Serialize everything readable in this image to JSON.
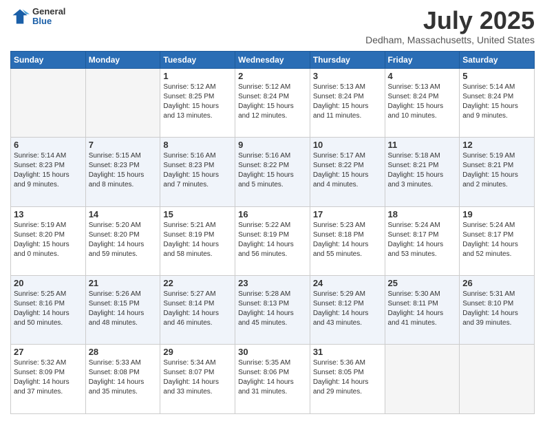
{
  "logo": {
    "general": "General",
    "blue": "Blue"
  },
  "header": {
    "month": "July 2025",
    "location": "Dedham, Massachusetts, United States"
  },
  "weekdays": [
    "Sunday",
    "Monday",
    "Tuesday",
    "Wednesday",
    "Thursday",
    "Friday",
    "Saturday"
  ],
  "weeks": [
    [
      {
        "day": "",
        "info": ""
      },
      {
        "day": "",
        "info": ""
      },
      {
        "day": "1",
        "info": "Sunrise: 5:12 AM\nSunset: 8:25 PM\nDaylight: 15 hours\nand 13 minutes."
      },
      {
        "day": "2",
        "info": "Sunrise: 5:12 AM\nSunset: 8:24 PM\nDaylight: 15 hours\nand 12 minutes."
      },
      {
        "day": "3",
        "info": "Sunrise: 5:13 AM\nSunset: 8:24 PM\nDaylight: 15 hours\nand 11 minutes."
      },
      {
        "day": "4",
        "info": "Sunrise: 5:13 AM\nSunset: 8:24 PM\nDaylight: 15 hours\nand 10 minutes."
      },
      {
        "day": "5",
        "info": "Sunrise: 5:14 AM\nSunset: 8:24 PM\nDaylight: 15 hours\nand 9 minutes."
      }
    ],
    [
      {
        "day": "6",
        "info": "Sunrise: 5:14 AM\nSunset: 8:23 PM\nDaylight: 15 hours\nand 9 minutes."
      },
      {
        "day": "7",
        "info": "Sunrise: 5:15 AM\nSunset: 8:23 PM\nDaylight: 15 hours\nand 8 minutes."
      },
      {
        "day": "8",
        "info": "Sunrise: 5:16 AM\nSunset: 8:23 PM\nDaylight: 15 hours\nand 7 minutes."
      },
      {
        "day": "9",
        "info": "Sunrise: 5:16 AM\nSunset: 8:22 PM\nDaylight: 15 hours\nand 5 minutes."
      },
      {
        "day": "10",
        "info": "Sunrise: 5:17 AM\nSunset: 8:22 PM\nDaylight: 15 hours\nand 4 minutes."
      },
      {
        "day": "11",
        "info": "Sunrise: 5:18 AM\nSunset: 8:21 PM\nDaylight: 15 hours\nand 3 minutes."
      },
      {
        "day": "12",
        "info": "Sunrise: 5:19 AM\nSunset: 8:21 PM\nDaylight: 15 hours\nand 2 minutes."
      }
    ],
    [
      {
        "day": "13",
        "info": "Sunrise: 5:19 AM\nSunset: 8:20 PM\nDaylight: 15 hours\nand 0 minutes."
      },
      {
        "day": "14",
        "info": "Sunrise: 5:20 AM\nSunset: 8:20 PM\nDaylight: 14 hours\nand 59 minutes."
      },
      {
        "day": "15",
        "info": "Sunrise: 5:21 AM\nSunset: 8:19 PM\nDaylight: 14 hours\nand 58 minutes."
      },
      {
        "day": "16",
        "info": "Sunrise: 5:22 AM\nSunset: 8:19 PM\nDaylight: 14 hours\nand 56 minutes."
      },
      {
        "day": "17",
        "info": "Sunrise: 5:23 AM\nSunset: 8:18 PM\nDaylight: 14 hours\nand 55 minutes."
      },
      {
        "day": "18",
        "info": "Sunrise: 5:24 AM\nSunset: 8:17 PM\nDaylight: 14 hours\nand 53 minutes."
      },
      {
        "day": "19",
        "info": "Sunrise: 5:24 AM\nSunset: 8:17 PM\nDaylight: 14 hours\nand 52 minutes."
      }
    ],
    [
      {
        "day": "20",
        "info": "Sunrise: 5:25 AM\nSunset: 8:16 PM\nDaylight: 14 hours\nand 50 minutes."
      },
      {
        "day": "21",
        "info": "Sunrise: 5:26 AM\nSunset: 8:15 PM\nDaylight: 14 hours\nand 48 minutes."
      },
      {
        "day": "22",
        "info": "Sunrise: 5:27 AM\nSunset: 8:14 PM\nDaylight: 14 hours\nand 46 minutes."
      },
      {
        "day": "23",
        "info": "Sunrise: 5:28 AM\nSunset: 8:13 PM\nDaylight: 14 hours\nand 45 minutes."
      },
      {
        "day": "24",
        "info": "Sunrise: 5:29 AM\nSunset: 8:12 PM\nDaylight: 14 hours\nand 43 minutes."
      },
      {
        "day": "25",
        "info": "Sunrise: 5:30 AM\nSunset: 8:11 PM\nDaylight: 14 hours\nand 41 minutes."
      },
      {
        "day": "26",
        "info": "Sunrise: 5:31 AM\nSunset: 8:10 PM\nDaylight: 14 hours\nand 39 minutes."
      }
    ],
    [
      {
        "day": "27",
        "info": "Sunrise: 5:32 AM\nSunset: 8:09 PM\nDaylight: 14 hours\nand 37 minutes."
      },
      {
        "day": "28",
        "info": "Sunrise: 5:33 AM\nSunset: 8:08 PM\nDaylight: 14 hours\nand 35 minutes."
      },
      {
        "day": "29",
        "info": "Sunrise: 5:34 AM\nSunset: 8:07 PM\nDaylight: 14 hours\nand 33 minutes."
      },
      {
        "day": "30",
        "info": "Sunrise: 5:35 AM\nSunset: 8:06 PM\nDaylight: 14 hours\nand 31 minutes."
      },
      {
        "day": "31",
        "info": "Sunrise: 5:36 AM\nSunset: 8:05 PM\nDaylight: 14 hours\nand 29 minutes."
      },
      {
        "day": "",
        "info": ""
      },
      {
        "day": "",
        "info": ""
      }
    ]
  ]
}
